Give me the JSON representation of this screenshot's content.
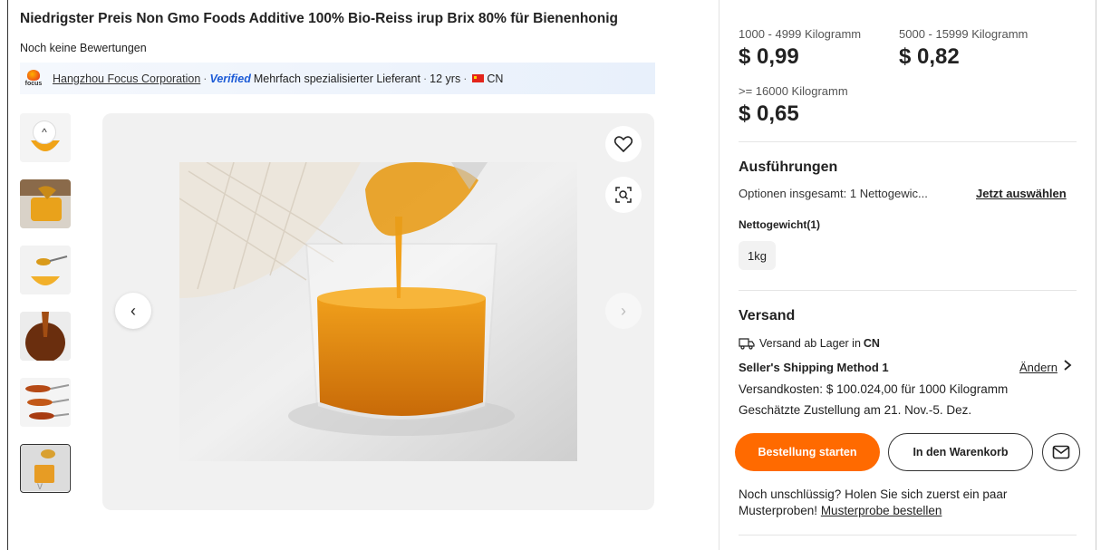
{
  "product": {
    "title": "Niedrigster Preis Non Gmo Foods Additive 100% Bio-Reiss irup Brix 80% für Bienenhonig",
    "reviews": "Noch keine Bewertungen"
  },
  "supplier": {
    "logo_text": "focus",
    "name": "Hangzhou Focus Corporation",
    "sep1": "·",
    "verified": "Verified",
    "type": "Mehrfach spezialisierter Lieferant",
    "sep2": "·",
    "years": "12 yrs",
    "sep3": "·",
    "country": "CN"
  },
  "gallery": {
    "thumbnail_count": 6,
    "active_index": 5,
    "prev_glyph": "‹",
    "next_glyph": "›",
    "thumb_up_glyph": "^",
    "thumb_down_glyph": "v"
  },
  "pricing": [
    {
      "range": "1000 - 4999 Kilogramm",
      "price": "$ 0,99"
    },
    {
      "range": "5000 - 15999 Kilogramm",
      "price": "$ 0,82"
    },
    {
      "range": ">= 16000 Kilogramm",
      "price": "$ 0,65"
    }
  ],
  "variants": {
    "title": "Ausführungen",
    "options_text": "Optionen insgesamt: 1 Nettogewic...",
    "select_link": "Jetzt auswählen",
    "weight_label": "Nettogewicht(1)",
    "weight_option": "1kg"
  },
  "shipping": {
    "title": "Versand",
    "ship_from": "Versand ab Lager in",
    "ship_from_country": "CN",
    "method": "Seller's Shipping Method 1",
    "change": "Ändern",
    "cost": "Versandkosten: $ 100.024,00 für 1000 Kilogramm",
    "delivery": "Geschätzte Zustellung am 21. Nov.-5. Dez."
  },
  "actions": {
    "order": "Bestellung starten",
    "cart": "In den Warenkorb"
  },
  "samples": {
    "text": "Noch unschlüssig? Holen Sie sich zuerst ein paar Musterproben!",
    "link": "Musterprobe bestellen"
  },
  "colors": {
    "accent": "#ff6a00",
    "verified": "#1c5bd6",
    "honey": "#e8950f"
  }
}
